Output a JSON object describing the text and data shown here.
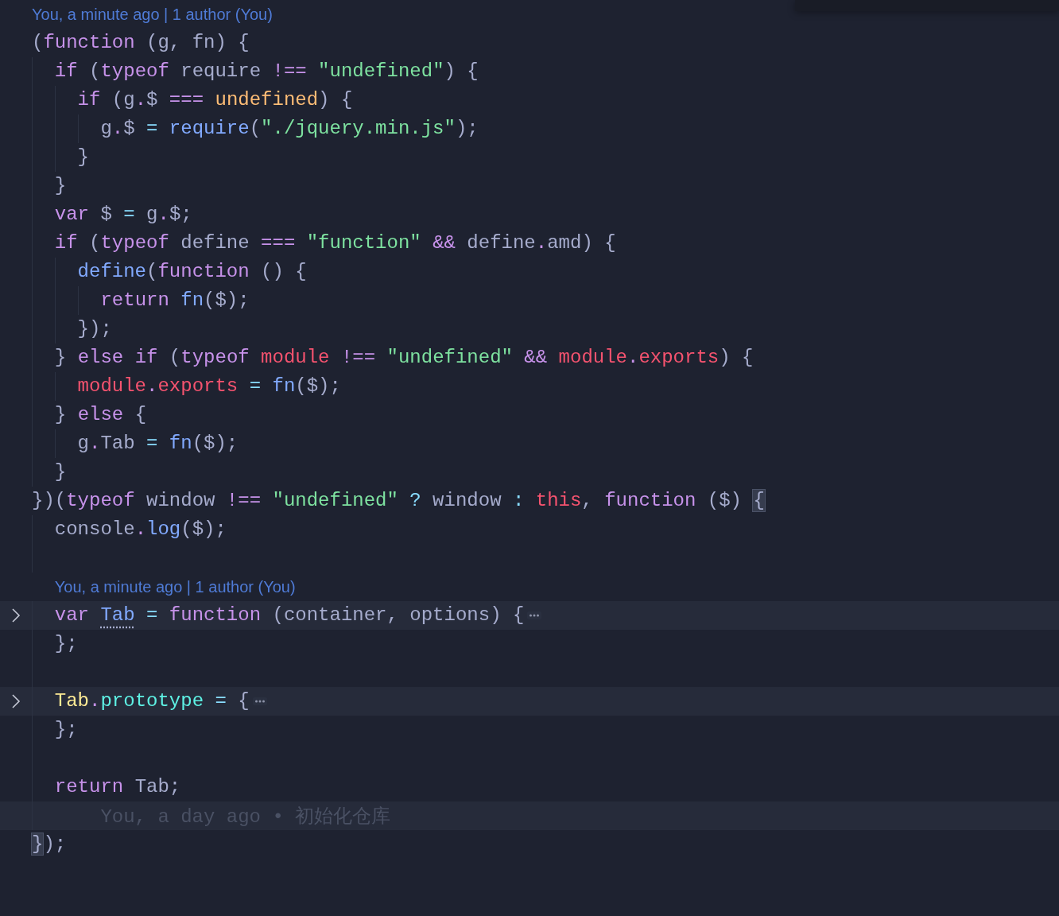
{
  "editor": {
    "lines": [
      {
        "kind": "codelens",
        "text": "You, a minute ago | 1 author (You)"
      },
      {
        "kind": "code",
        "folded": false,
        "tokens": [
          {
            "text": "(",
            "kind": "plain"
          },
          {
            "text": "function",
            "kind": "keyword"
          },
          {
            "text": " (g, fn) {",
            "kind": "plain"
          }
        ]
      },
      {
        "kind": "code",
        "folded": false,
        "tokens": [
          {
            "text": "  if",
            "kind": "keyword"
          },
          {
            "text": " (",
            "kind": "plain"
          },
          {
            "text": "typeof",
            "kind": "keyword"
          },
          {
            "text": " require ",
            "kind": "plain"
          },
          {
            "text": "!==",
            "kind": "operator"
          },
          {
            "text": " \"undefined\"",
            "kind": "string"
          },
          {
            "text": ") {",
            "kind": "plain"
          }
        ]
      },
      {
        "kind": "code",
        "folded": false,
        "tokens": [
          {
            "text": "    if",
            "kind": "keyword"
          },
          {
            "text": " (g",
            "kind": "plain"
          },
          {
            "text": ".",
            "kind": "operator"
          },
          {
            "text": "$ ",
            "kind": "plain"
          },
          {
            "text": "===",
            "kind": "operator"
          },
          {
            "text": " undefined",
            "kind": "constant"
          },
          {
            "text": ") {",
            "kind": "plain"
          }
        ]
      },
      {
        "kind": "code",
        "folded": false,
        "tokens": [
          {
            "text": "      g",
            "kind": "plain"
          },
          {
            "text": ".",
            "kind": "operator"
          },
          {
            "text": "$ ",
            "kind": "plain"
          },
          {
            "text": "=",
            "kind": "assign"
          },
          {
            "text": " require",
            "kind": "function"
          },
          {
            "text": "(",
            "kind": "plain"
          },
          {
            "text": "\"./jquery.min.js\"",
            "kind": "string"
          },
          {
            "text": ");",
            "kind": "plain"
          }
        ]
      },
      {
        "kind": "code",
        "folded": false,
        "tokens": [
          {
            "text": "    }",
            "kind": "plain"
          }
        ]
      },
      {
        "kind": "code",
        "folded": false,
        "tokens": [
          {
            "text": "  }",
            "kind": "plain"
          }
        ]
      },
      {
        "kind": "code",
        "folded": false,
        "tokens": [
          {
            "text": "  var",
            "kind": "keyword"
          },
          {
            "text": " $ ",
            "kind": "plain"
          },
          {
            "text": "=",
            "kind": "assign"
          },
          {
            "text": " g",
            "kind": "plain"
          },
          {
            "text": ".",
            "kind": "operator"
          },
          {
            "text": "$;",
            "kind": "plain"
          }
        ]
      },
      {
        "kind": "code",
        "folded": false,
        "tokens": [
          {
            "text": "  if",
            "kind": "keyword"
          },
          {
            "text": " (",
            "kind": "plain"
          },
          {
            "text": "typeof",
            "kind": "keyword"
          },
          {
            "text": " define ",
            "kind": "plain"
          },
          {
            "text": "===",
            "kind": "operator"
          },
          {
            "text": " \"function\"",
            "kind": "string"
          },
          {
            "text": " &&",
            "kind": "operator"
          },
          {
            "text": " define",
            "kind": "plain"
          },
          {
            "text": ".",
            "kind": "operator"
          },
          {
            "text": "amd) {",
            "kind": "plain"
          }
        ]
      },
      {
        "kind": "code",
        "folded": false,
        "tokens": [
          {
            "text": "    define",
            "kind": "function"
          },
          {
            "text": "(",
            "kind": "plain"
          },
          {
            "text": "function",
            "kind": "keyword"
          },
          {
            "text": " () {",
            "kind": "plain"
          }
        ]
      },
      {
        "kind": "code",
        "folded": false,
        "tokens": [
          {
            "text": "      return",
            "kind": "keyword"
          },
          {
            "text": " fn",
            "kind": "function"
          },
          {
            "text": "($);",
            "kind": "plain"
          }
        ]
      },
      {
        "kind": "code",
        "folded": false,
        "tokens": [
          {
            "text": "    });",
            "kind": "plain"
          }
        ]
      },
      {
        "kind": "code",
        "folded": false,
        "tokens": [
          {
            "text": "  } ",
            "kind": "plain"
          },
          {
            "text": "else",
            "kind": "keyword"
          },
          {
            "text": " if",
            "kind": "keyword"
          },
          {
            "text": " (",
            "kind": "plain"
          },
          {
            "text": "typeof",
            "kind": "keyword"
          },
          {
            "text": " module",
            "kind": "variable"
          },
          {
            "text": " !==",
            "kind": "operator"
          },
          {
            "text": " \"undefined\"",
            "kind": "string"
          },
          {
            "text": " &&",
            "kind": "operator"
          },
          {
            "text": " module",
            "kind": "variable"
          },
          {
            "text": ".",
            "kind": "operator"
          },
          {
            "text": "exports",
            "kind": "variable"
          },
          {
            "text": ") {",
            "kind": "plain"
          }
        ]
      },
      {
        "kind": "code",
        "folded": false,
        "tokens": [
          {
            "text": "    module",
            "kind": "variable"
          },
          {
            "text": ".",
            "kind": "operator"
          },
          {
            "text": "exports",
            "kind": "variable"
          },
          {
            "text": " =",
            "kind": "assign"
          },
          {
            "text": " fn",
            "kind": "function"
          },
          {
            "text": "($);",
            "kind": "plain"
          }
        ]
      },
      {
        "kind": "code",
        "folded": false,
        "tokens": [
          {
            "text": "  } ",
            "kind": "plain"
          },
          {
            "text": "else",
            "kind": "keyword"
          },
          {
            "text": " {",
            "kind": "plain"
          }
        ]
      },
      {
        "kind": "code",
        "folded": false,
        "tokens": [
          {
            "text": "    g",
            "kind": "plain"
          },
          {
            "text": ".",
            "kind": "operator"
          },
          {
            "text": "Tab ",
            "kind": "plain"
          },
          {
            "text": "=",
            "kind": "assign"
          },
          {
            "text": " fn",
            "kind": "function"
          },
          {
            "text": "($);",
            "kind": "plain"
          }
        ]
      },
      {
        "kind": "code",
        "folded": false,
        "tokens": [
          {
            "text": "  }",
            "kind": "plain"
          }
        ]
      },
      {
        "kind": "code",
        "folded": false,
        "tokens": [
          {
            "text": "})(",
            "kind": "plain"
          },
          {
            "text": "typeof",
            "kind": "keyword"
          },
          {
            "text": " window ",
            "kind": "plain"
          },
          {
            "text": "!==",
            "kind": "operator"
          },
          {
            "text": " \"undefined\"",
            "kind": "string"
          },
          {
            "text": " ?",
            "kind": "assign"
          },
          {
            "text": " window ",
            "kind": "plain"
          },
          {
            "text": ":",
            "kind": "assign"
          },
          {
            "text": " this",
            "kind": "variable"
          },
          {
            "text": ", ",
            "kind": "plain"
          },
          {
            "text": "function",
            "kind": "keyword"
          },
          {
            "text": " ($) ",
            "kind": "plain"
          },
          {
            "text": "{",
            "kind": "bracket"
          }
        ]
      },
      {
        "kind": "code",
        "folded": false,
        "tokens": [
          {
            "text": "  console",
            "kind": "plain"
          },
          {
            "text": ".",
            "kind": "operator"
          },
          {
            "text": "log",
            "kind": "function"
          },
          {
            "text": "($);",
            "kind": "plain"
          }
        ]
      },
      {
        "kind": "blank"
      },
      {
        "kind": "codelens",
        "text": "You, a minute ago | 1 author (You)"
      },
      {
        "kind": "code",
        "folded": true,
        "tokens": [
          {
            "text": "  var ",
            "kind": "keyword"
          },
          {
            "text": "Tab",
            "kind": "hint"
          },
          {
            "text": " =",
            "kind": "assign"
          },
          {
            "text": " function",
            "kind": "keyword"
          },
          {
            "text": " (container, options) {",
            "kind": "plain"
          }
        ]
      },
      {
        "kind": "code",
        "folded": false,
        "tokens": [
          {
            "text": "  };",
            "kind": "plain"
          }
        ]
      },
      {
        "kind": "blank"
      },
      {
        "kind": "code",
        "folded": true,
        "tokens": [
          {
            "text": "  Tab",
            "kind": "class"
          },
          {
            "text": ".",
            "kind": "operator"
          },
          {
            "text": "prototype",
            "kind": "property"
          },
          {
            "text": " =",
            "kind": "assign"
          },
          {
            "text": " {",
            "kind": "plain"
          }
        ]
      },
      {
        "kind": "code",
        "folded": false,
        "tokens": [
          {
            "text": "  };",
            "kind": "plain"
          }
        ]
      },
      {
        "kind": "blank"
      },
      {
        "kind": "code",
        "folded": false,
        "tokens": [
          {
            "text": "  return",
            "kind": "keyword"
          },
          {
            "text": " Tab;",
            "kind": "plain"
          }
        ]
      },
      {
        "kind": "blame",
        "text": "You, a day ago • 初始化仓库"
      },
      {
        "kind": "code",
        "folded": false,
        "tokens": [
          {
            "text": "}",
            "kind": "bracket"
          },
          {
            "text": ");",
            "kind": "plain"
          }
        ]
      }
    ]
  }
}
